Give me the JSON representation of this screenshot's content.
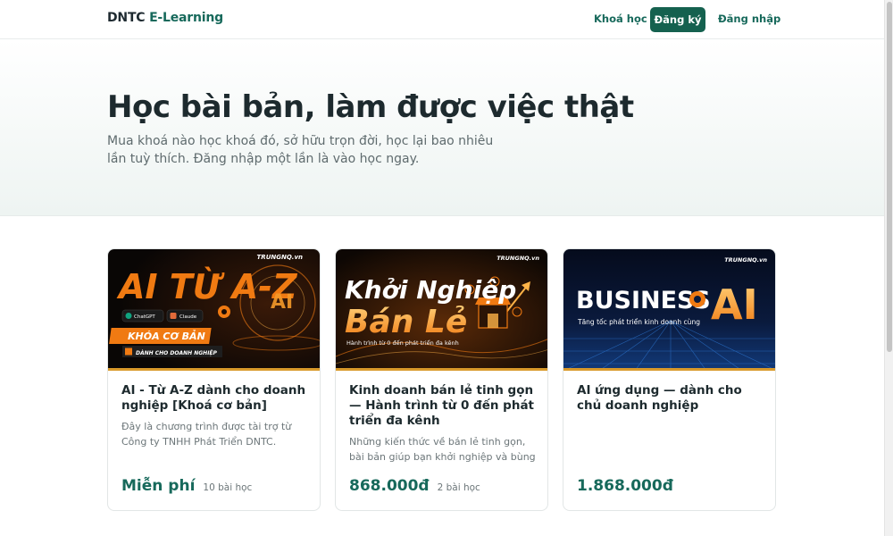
{
  "header": {
    "logo_brand": "DNTC",
    "logo_accent": "E-Learning",
    "nav": {
      "courses": "Khoá học",
      "register": "Đăng ký",
      "login": "Đăng nhập"
    }
  },
  "hero": {
    "title": "Học bài bản, làm được việc thật",
    "subtitle": "Mua khoá nào học khoá đó, sở hữu trọn đời, học lại bao nhiêu lần tuỳ thích. Đăng nhập một lần là vào học ngay."
  },
  "colors": {
    "primary": "#17695b",
    "button_bg": "#15614f",
    "orange": "#f07a12",
    "gold": "#d99a2b"
  },
  "courses": [
    {
      "title": "AI - Từ A-Z dành cho doanh nghiệp [Khoá cơ bản]",
      "description": "Đây là chương trình được tài trợ từ Công ty TNHH Phát Triển DNTC.",
      "price": "Miễn phí",
      "lessons": "10 bài học",
      "thumb": {
        "brand": "TRUNGNQ.vn",
        "headline": "AI TỪ A-Z",
        "badge": "KHÓA CƠ BẢN",
        "tagline": "DÀNH CHO DOANH NGHIỆP",
        "chip1": "ChatGPT",
        "chip2": "Claude",
        "ai_mark": "AI"
      }
    },
    {
      "title": "Kinh doanh bán lẻ tinh gọn — Hành trình từ 0 đến phát triển đa kênh",
      "description": "Những kiến thức về bán lẻ tinh gọn, bài bản giúp bạn khởi nghiệp và bùng phá...",
      "price": "868.000đ",
      "lessons": "2 bài học",
      "thumb": {
        "brand": "TRUNGNQ.vn",
        "headline_1": "Khởi Nghiệp",
        "headline_2": "Bán Lẻ",
        "tagline": "Hành trình từ 0 đến phát triển đa kênh"
      }
    },
    {
      "title": "AI ứng dụng — dành cho chủ doanh nghiệp",
      "description": "",
      "price": "1.868.000đ",
      "lessons": "",
      "thumb": {
        "brand": "TRUNGNQ.vn",
        "headline_1": "BUSINESS",
        "headline_2": "AI",
        "tagline": "Tăng tốc phát triển kinh doanh cùng"
      }
    }
  ]
}
